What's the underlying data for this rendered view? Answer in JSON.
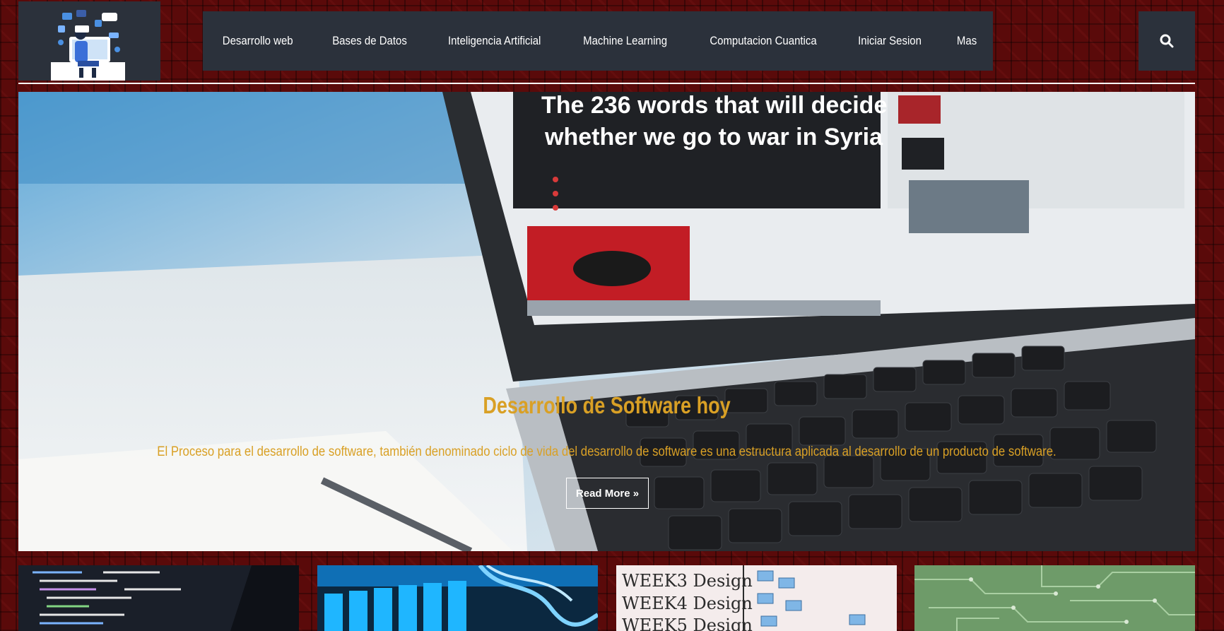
{
  "header": {
    "logo_icon": "developer-illustration",
    "search_icon": "search-icon"
  },
  "nav": {
    "items": [
      {
        "label": "Desarrollo web"
      },
      {
        "label": "Bases de Datos"
      },
      {
        "label": "Inteligencia Artificial"
      },
      {
        "label": "Machine Learning"
      },
      {
        "label": "Computacion Cuantica"
      },
      {
        "label": "Iniciar Sesion"
      },
      {
        "label": "Mas"
      }
    ]
  },
  "hero": {
    "image_icon": "laptop-news-photo",
    "title": "Desarrollo de Software hoy",
    "description": "El Proceso para el desarrollo de software, también denominado ciclo de vida del desarrollo de software es una estructura aplicada al desarrollo de un producto de software.",
    "button_label": "Read More »",
    "screen_headline_line1": "The 236 words that will decide",
    "screen_headline_line2": "whether we go to war in Syria"
  },
  "thumbnails": [
    {
      "icon": "code-editor-photo"
    },
    {
      "icon": "server-cables-photo"
    },
    {
      "icon": "whiteboard-weeks-photo"
    },
    {
      "icon": "circuit-board-photo"
    }
  ],
  "whiteboard_text": [
    "WEEK3 Design",
    "WEEK4 Design",
    "WEEK5 Design"
  ],
  "colors": {
    "background": "#5a0a0a",
    "nav_bg": "#2b313b",
    "accent": "#d9a025",
    "text_light": "#ffffff"
  }
}
